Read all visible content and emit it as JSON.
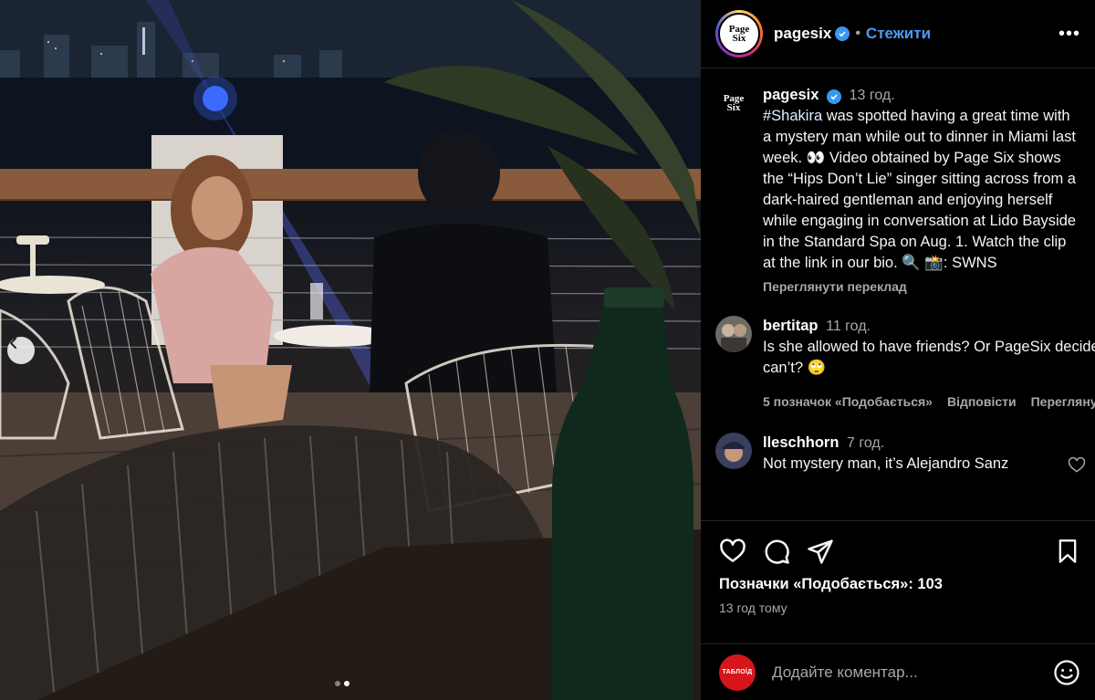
{
  "post": {
    "account": "pagesix",
    "follow_label": "Стежити",
    "logo_line1": "Page",
    "logo_line2": "Six",
    "more_label": "•••",
    "carousel": {
      "slide_count": 2,
      "active_index": 1
    }
  },
  "caption": {
    "username": "pagesix",
    "time": "13 год.",
    "hashtag": "#Shakira",
    "text": " was spotted having a great time with a mystery man while out to dinner in Miami last week. 👀 Video obtained by Page Six shows the “Hips Don’t Lie” singer sitting across from a dark-haired gentleman and enjoying herself while engaging in conversation at Lido Bayside in the Standard Spa on Aug. 1. Watch the clip at the link in our bio. 🔍 📸: SWNS",
    "translate_label": "Переглянути переклад"
  },
  "comments": [
    {
      "username": "bertitap",
      "time": "11 год.",
      "text": "Is she allowed to have friends? Or PageSix decided she can’t? 🙄",
      "likes_label": "5 позначок «Подобається»",
      "reply_label": "Відповісти",
      "extra_label": "Переглянути переклад"
    },
    {
      "username": "lleschhorn",
      "time": "7 год.",
      "text": "Not mystery man, it’s Alejandro Sanz"
    }
  ],
  "actions": {
    "likes_text": "Позначки «Подобається»: 103",
    "posted_time": "13 год тому"
  },
  "add_comment": {
    "avatar_label": "ТАБЛОЇД",
    "placeholder": "Додайте коментар..."
  },
  "colors": {
    "accent": "#4a9cf5",
    "verified": "#3897f0",
    "secondary_text": "#a8a8a8",
    "avatar_red": "#d6161b"
  },
  "icons": [
    "chevron-left-icon",
    "verified-icon",
    "more-icon",
    "heart-icon",
    "comment-icon",
    "share-icon",
    "bookmark-icon",
    "emoji-icon"
  ]
}
